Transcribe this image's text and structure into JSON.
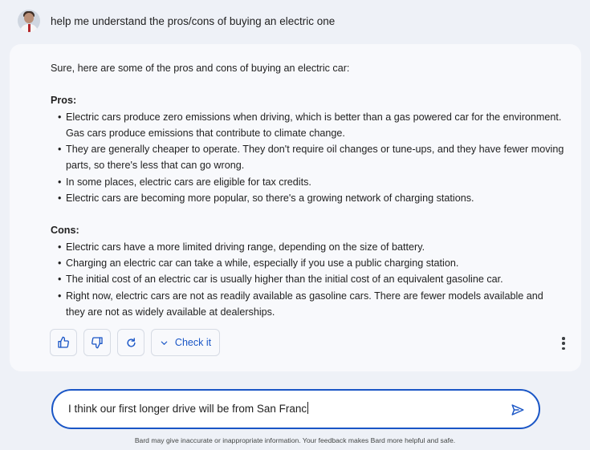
{
  "prompt": {
    "text": "help me understand the pros/cons of buying an electric one"
  },
  "response": {
    "intro": "Sure, here are some of the pros and cons of buying an electric car:",
    "pros_title": "Pros:",
    "pros": [
      "Electric cars produce zero emissions when driving, which is better than a gas powered car for the environment. Gas cars produce emissions that contribute to climate change.",
      "They are generally cheaper to operate. They don't require oil changes or tune-ups, and they have fewer moving parts, so there's less that can go wrong.",
      "In some places, electric cars are eligible for tax credits.",
      "Electric cars are becoming more popular, so there's a growing network of charging stations."
    ],
    "cons_title": "Cons:",
    "cons": [
      "Electric cars have a more limited driving range, depending on the size of battery.",
      "Charging an electric car can take a while, especially if you use a public charging station.",
      "The initial cost of an electric car is usually higher than the initial cost of an equivalent gasoline car.",
      "Right now, electric cars are not as readily available as gasoline cars. There are fewer models available and they are not as widely available at dealerships."
    ]
  },
  "actions": {
    "thumbs_up_icon": "thumbs-up-icon",
    "thumbs_down_icon": "thumbs-down-icon",
    "regenerate_icon": "refresh-icon",
    "check_label": "Check it",
    "more_icon": "more-vert-icon"
  },
  "input": {
    "value": "I think our first longer drive will be from San Franc",
    "send_icon": "send-icon"
  },
  "disclaimer": "Bard may give inaccurate or inappropriate information. Your feedback makes Bard more helpful and safe.",
  "colors": {
    "accent": "#1a56c6",
    "background": "#eef1f7",
    "card": "#f8f9fc"
  }
}
